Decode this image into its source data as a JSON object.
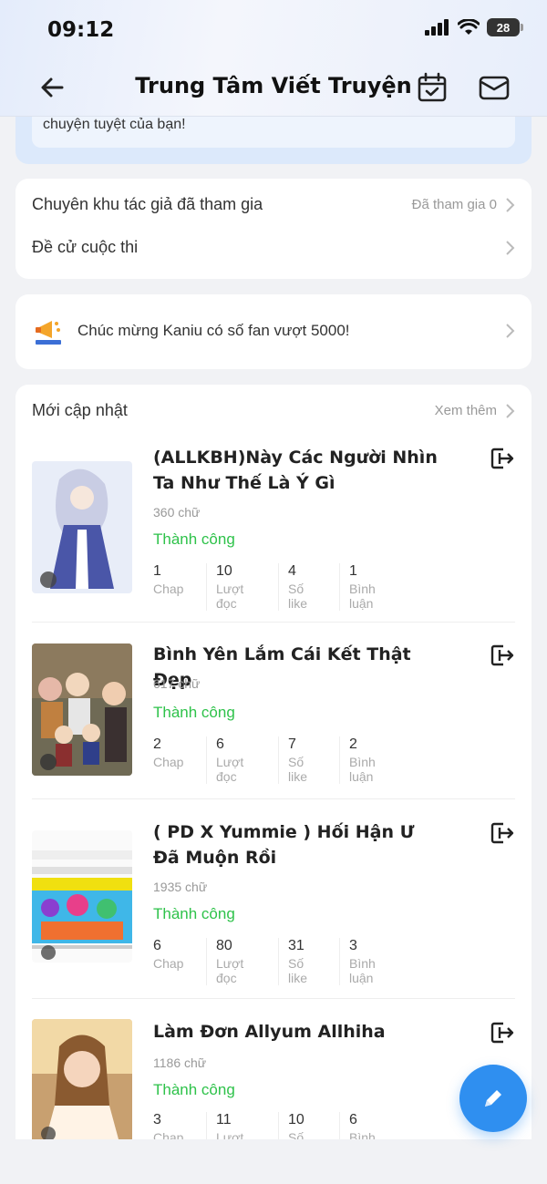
{
  "status_bar": {
    "time": "09:12",
    "battery": "28"
  },
  "header": {
    "title": "Trung Tâm Viết Truyện"
  },
  "banner": {
    "text": "chuyện tuyệt của bạn!"
  },
  "menu": {
    "items": [
      {
        "label": "Chuyên khu tác giả đã tham gia",
        "value": "Đã tham gia 0"
      },
      {
        "label": "Đề cử cuộc thi",
        "value": ""
      }
    ]
  },
  "notice": {
    "text": "Chúc mừng Kaniu có số fan vượt 5000!"
  },
  "updates": {
    "title": "Mới cập nhật",
    "see_more": "Xem thêm",
    "stat_labels": {
      "chap": "Chap",
      "reads": "Lượt đọc",
      "likes": "Số like",
      "comments": "Bình luận"
    },
    "stories": [
      {
        "title": "(ALLKBH)Này Các Người Nhìn Ta Như Thế Là Ý Gì",
        "words": "360 chữ",
        "status": "Thành công",
        "chap": "1",
        "reads": "10",
        "likes": "4",
        "comments": "1",
        "cover_color": "#e8edf8"
      },
      {
        "title": "Bình Yên Lắm Cái Kết Thật Đẹp",
        "words": "617 chữ",
        "status": "Thành công",
        "chap": "2",
        "reads": "6",
        "likes": "7",
        "comments": "2",
        "cover_color": "#a39478"
      },
      {
        "title": "( PD X Yummie ) Hối Hận Ư Đã Muộn Rồi",
        "words": "1935 chữ",
        "status": "Thành công",
        "chap": "6",
        "reads": "80",
        "likes": "31",
        "comments": "3",
        "cover_color": "#3fb7e8"
      },
      {
        "title": "Làm Đơn Allyum Allhiha",
        "words": "1186 chữ",
        "status": "Thành công",
        "chap": "3",
        "reads": "11",
        "likes": "10",
        "comments": "6",
        "cover_color": "#e7c9a4"
      }
    ]
  },
  "colors": {
    "accent": "#2f8ff0",
    "success": "#2ec24a"
  }
}
